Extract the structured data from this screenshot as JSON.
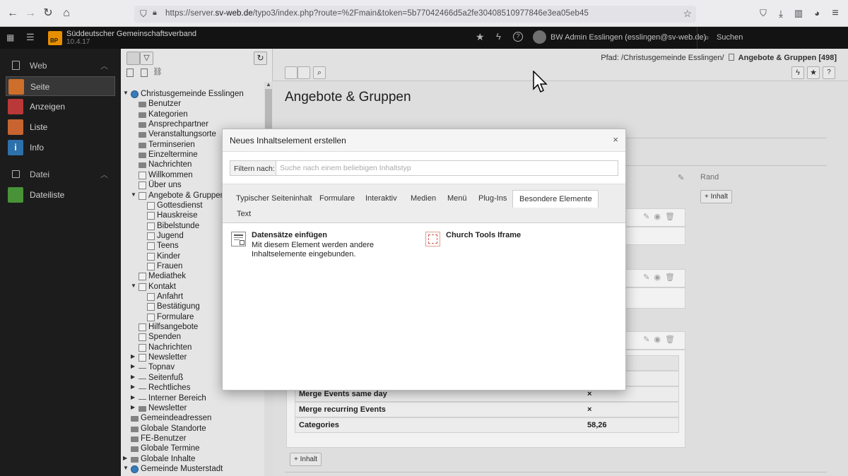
{
  "browser": {
    "url_prefix": "https://server.",
    "url_host": "sv-web.de",
    "url_path": "/typo3/index.php?route=%2Fmain&token=5b77042466d5a2fe30408510977846e3ea05eb45"
  },
  "topbar": {
    "site_name": "Süddeutscher Gemeinschaftsverband",
    "version": "10.4.17",
    "logo_letters": "BP",
    "user": "BW Admin Esslingen (esslingen@sv-web.de)",
    "search_label": "Suchen"
  },
  "module_menu": {
    "web_group": "Web",
    "items_web": [
      {
        "label": "Seite",
        "color": "#d9742e"
      },
      {
        "label": "Anzeigen",
        "color": "#c43b3b"
      },
      {
        "label": "Liste",
        "color": "#d26a33"
      },
      {
        "label": "Info",
        "color": "#2f78b5"
      }
    ],
    "file_group": "Datei",
    "items_file": [
      {
        "label": "Dateiliste",
        "color": "#4c9a3a"
      }
    ]
  },
  "tree": {
    "rows": [
      {
        "label": "Christusgemeinde Esslingen",
        "toggle": "▼"
      },
      {
        "label": "Benutzer"
      },
      {
        "label": "Kategorien"
      },
      {
        "label": "Ansprechpartner"
      },
      {
        "label": "Veranstaltungsorte"
      },
      {
        "label": "Terminserien"
      },
      {
        "label": "Einzeltermine"
      },
      {
        "label": "Nachrichten"
      },
      {
        "label": "Willkommen"
      },
      {
        "label": "Über uns"
      },
      {
        "label": "Angebote & Gruppen",
        "toggle": "▼"
      },
      {
        "label": "Gottesdienst"
      },
      {
        "label": "Hauskreise"
      },
      {
        "label": "Bibelstunde"
      },
      {
        "label": "Jugend"
      },
      {
        "label": "Teens"
      },
      {
        "label": "Kinder"
      },
      {
        "label": "Frauen"
      },
      {
        "label": "Mediathek"
      },
      {
        "label": "Kontakt",
        "toggle": "▼"
      },
      {
        "label": "Anfahrt"
      },
      {
        "label": "Bestätigung"
      },
      {
        "label": "Formulare"
      },
      {
        "label": "Hilfsangebote"
      },
      {
        "label": "Spenden"
      },
      {
        "label": "Nachrichten"
      },
      {
        "label": "Newsletter",
        "toggle": "▶"
      },
      {
        "label": "Topnav",
        "toggle": "▶"
      },
      {
        "label": "Seitenfuß",
        "toggle": "▶"
      },
      {
        "label": "Rechtliches",
        "toggle": "▶"
      },
      {
        "label": "Interner Bereich",
        "toggle": "▶"
      },
      {
        "label": "Newsletter",
        "toggle": "▶"
      },
      {
        "label": "Gemeindeadressen"
      },
      {
        "label": "Globale Standorte"
      },
      {
        "label": "FE-Benutzer"
      },
      {
        "label": "Globale Termine"
      },
      {
        "label": "Globale Inhalte",
        "toggle": "▶"
      },
      {
        "label": "Gemeinde Musterstadt",
        "toggle": "▼"
      }
    ]
  },
  "content": {
    "path_label": "Pfad: /Christusgemeinde Esslingen/",
    "path_page": "Angebote & Gruppen [498]",
    "page_title": "Angebote & Gruppen",
    "column_rand": "Rand",
    "add_content_label": "Inhalt",
    "table_rows": [
      {
        "key": "Merge Events same day",
        "value": "×"
      },
      {
        "key": "Merge recurring Events",
        "value": "×"
      },
      {
        "key": "Categories",
        "value": "58,26"
      }
    ]
  },
  "modal": {
    "title": "Neues Inhaltselement erstellen",
    "close": "×",
    "filter_label": "Filtern nach:",
    "filter_placeholder": "Suche nach einem beliebigen Inhaltstyp",
    "tabs": [
      "Typischer Seiteninhalt",
      "Formulare",
      "Interaktiv",
      "Medien",
      "Menü",
      "Plug-Ins",
      "Besondere Elemente",
      "Text"
    ],
    "active_tab": "Besondere Elemente",
    "elements": [
      {
        "title": "Datensätze einfügen",
        "desc": "Mit diesem Element werden andere Inhaltselemente eingebunden."
      },
      {
        "title": "Church Tools Iframe",
        "desc": ""
      }
    ]
  }
}
